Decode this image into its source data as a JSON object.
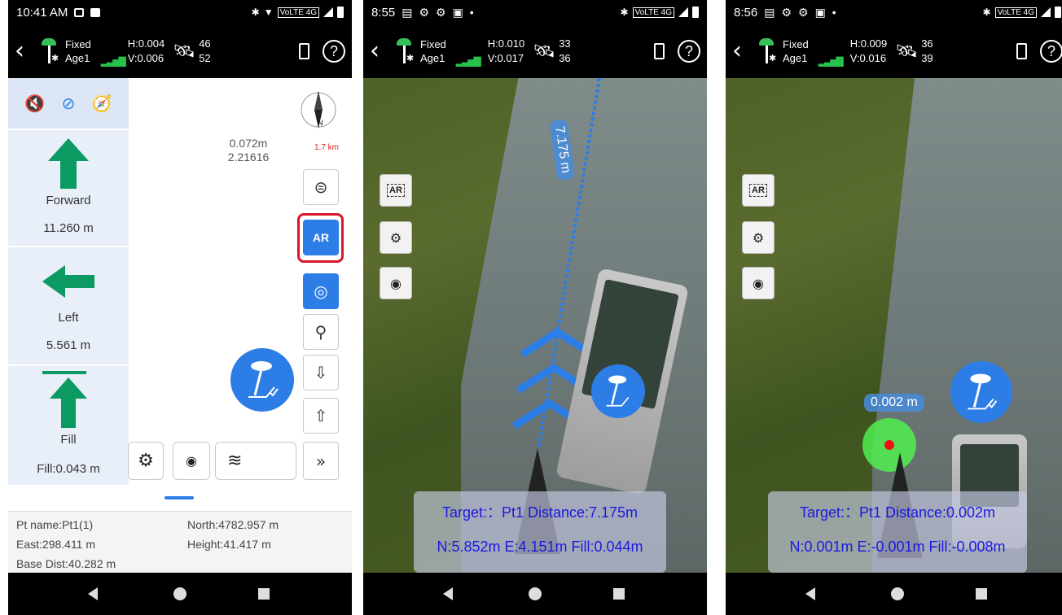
{
  "screens": [
    {
      "status": {
        "time": "10:41 AM",
        "network": "VoLTE 4G"
      },
      "header": {
        "fix": "Fixed",
        "age": "Age1",
        "h": "H:0.004",
        "v": "V:0.006",
        "sat_top": "46",
        "sat_bottom": "52"
      },
      "panel": {
        "forward_label": "Forward",
        "forward_value": "11.260 m",
        "left_label": "Left",
        "left_value": "5.561 m",
        "fill_label": "Fill",
        "fill_value": "Fill:0.043 m"
      },
      "center": {
        "line1": "0.072m",
        "line2": "2.21616"
      },
      "compass": {
        "north": "N",
        "distance": "1.7 km"
      },
      "ar_button_label": "AR",
      "info": {
        "pt_name": "Pt name:Pt1(1)",
        "north": "North:4782.957 m",
        "east": "East:298.411 m",
        "height": "Height:41.417 m",
        "base_dist": "Base Dist:40.282 m"
      }
    },
    {
      "status": {
        "time": "8:55",
        "network": "VoLTE 4G"
      },
      "header": {
        "fix": "Fixed",
        "age": "Age1",
        "h": "H:0.010",
        "v": "V:0.017",
        "sat_top": "33",
        "sat_bottom": "36"
      },
      "ar_label": "AR",
      "distance_label": "7.175 m",
      "target_line": "Target:：Pt1 Distance:7.175m",
      "offset_line": "N:5.852m E:4.151m Fill:0.044m"
    },
    {
      "status": {
        "time": "8:56",
        "network": "VoLTE 4G"
      },
      "header": {
        "fix": "Fixed",
        "age": "Age1",
        "h": "H:0.009",
        "v": "V:0.016",
        "sat_top": "36",
        "sat_bottom": "39"
      },
      "ar_label": "AR",
      "distance_label": "0.002 m",
      "target_line": "Target:：Pt1 Distance:0.002m",
      "offset_line": "N:0.001m E:-0.001m Fill:-0.008m"
    }
  ],
  "colors": {
    "accent": "#2d7de6",
    "arrow_green": "#0a9a62",
    "highlight_red": "#d8162c",
    "info_text": "#1a1adf",
    "fix_green": "#36c05a"
  },
  "icons": [
    "mute-icon",
    "hide-icon",
    "compass-nav-icon",
    "gear-icon",
    "camera-icon",
    "layers-icon",
    "chevron-double-down-icon",
    "arrow-down-icon",
    "arrow-up-icon",
    "locate-icon",
    "target-icon",
    "pin-icon",
    "satellite-icon",
    "help-icon",
    "back-icon",
    "rover-icon"
  ]
}
